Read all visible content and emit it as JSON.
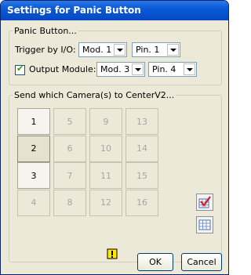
{
  "window": {
    "title": "Settings for Panic Button"
  },
  "panic_group": {
    "legend": "Panic Button...",
    "trigger_label": "Trigger by I/O:",
    "trigger_module": "Mod. 1",
    "trigger_pin": "Pin. 1",
    "output_checked": true,
    "output_label": "Output Module:",
    "output_module": "Mod. 3",
    "output_pin": "Pin. 4"
  },
  "camera_group": {
    "legend": "Send which Camera(s) to CenterV2...",
    "cells": [
      {
        "label": "1",
        "enabled": true
      },
      {
        "label": "5",
        "enabled": false
      },
      {
        "label": "9",
        "enabled": false
      },
      {
        "label": "13",
        "enabled": false
      },
      {
        "label": "2",
        "enabled": true,
        "selected": true
      },
      {
        "label": "6",
        "enabled": false
      },
      {
        "label": "10",
        "enabled": false
      },
      {
        "label": "14",
        "enabled": false
      },
      {
        "label": "3",
        "enabled": true
      },
      {
        "label": "7",
        "enabled": false
      },
      {
        "label": "11",
        "enabled": false
      },
      {
        "label": "15",
        "enabled": false
      },
      {
        "label": "4",
        "enabled": false
      },
      {
        "label": "8",
        "enabled": false
      },
      {
        "label": "12",
        "enabled": false
      },
      {
        "label": "16",
        "enabled": false
      }
    ]
  },
  "icons": {
    "select_all": "checked-grid-icon",
    "clear_all": "grid-icon",
    "warning": "warning-icon"
  },
  "buttons": {
    "ok": "OK",
    "cancel": "Cancel"
  }
}
